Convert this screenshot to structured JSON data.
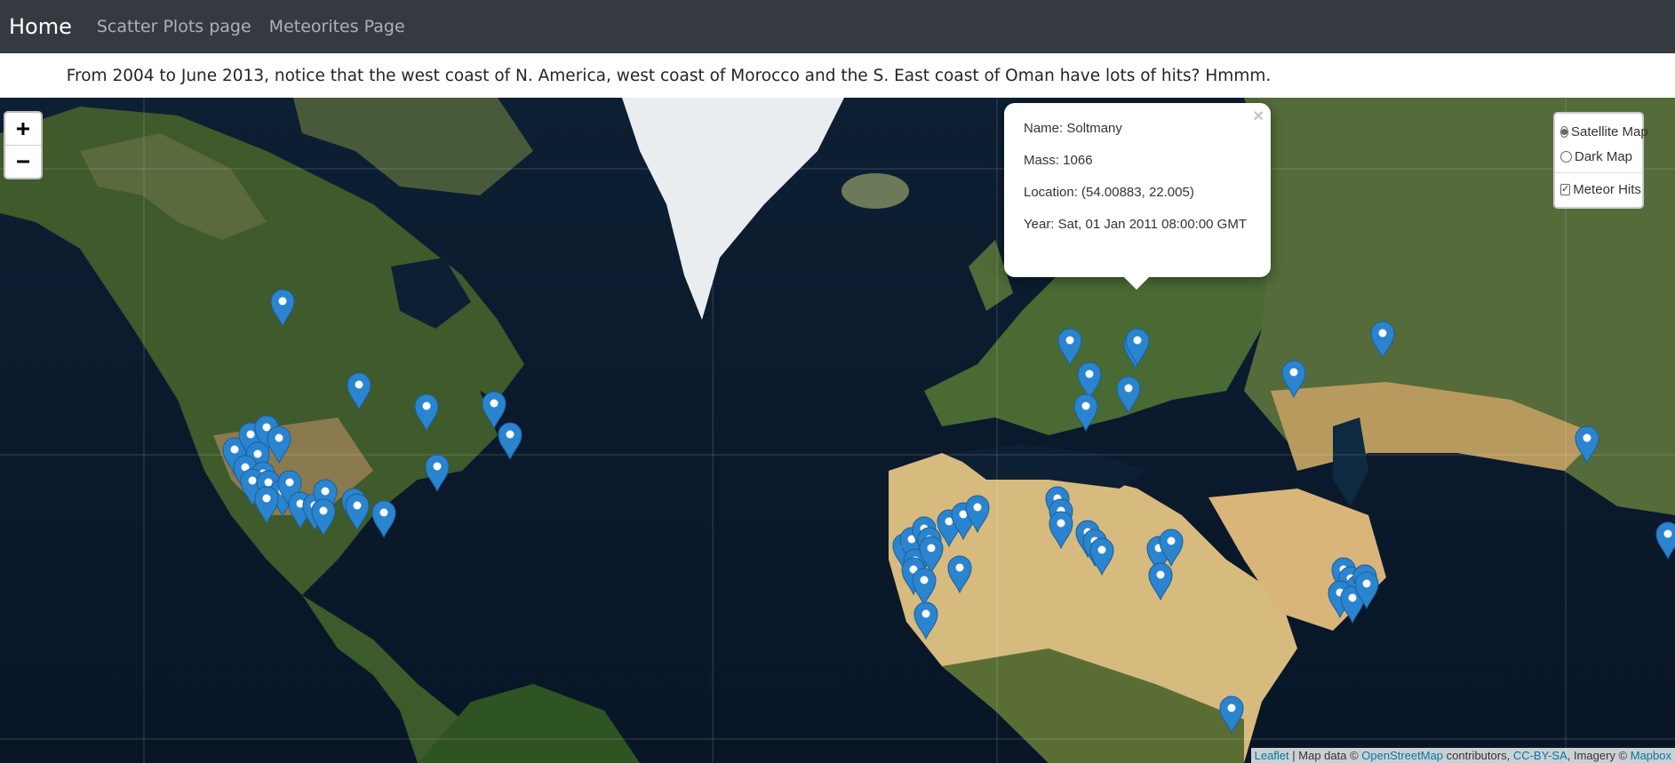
{
  "nav": {
    "brand": "Home",
    "links": [
      "Scatter Plots page",
      "Meteorites Page"
    ]
  },
  "banner": "From 2004 to June 2013, notice that the west coast of N. America, west coast of Morocco and the S. East coast of Oman have lots of hits? Hmmm.",
  "zoom": {
    "in": "+",
    "out": "−"
  },
  "layers": {
    "base": [
      "Satellite Map",
      "Dark Map"
    ],
    "selected": "Satellite Map",
    "overlay": "Meteor Hits",
    "overlay_checked": true
  },
  "popup": {
    "name": "Name: Soltmany",
    "mass": "Mass: 1066",
    "location": "Location: (54.00883, 22.005)",
    "year": "Year: Sat, 01 Jan 2011 08:00:00 GMT",
    "close": "×"
  },
  "attribution": {
    "leaflet": "Leaflet",
    "sep1": " | Map data © ",
    "osm": "OpenStreetMap",
    "sep2": " contributors, ",
    "license": "CC-BY-SA",
    "sep3": ", Imagery © ",
    "mapbox": "Mapbox"
  },
  "colors": {
    "marker": "#2a84cf",
    "navbar": "#343a40",
    "link": "#0078a8"
  }
}
